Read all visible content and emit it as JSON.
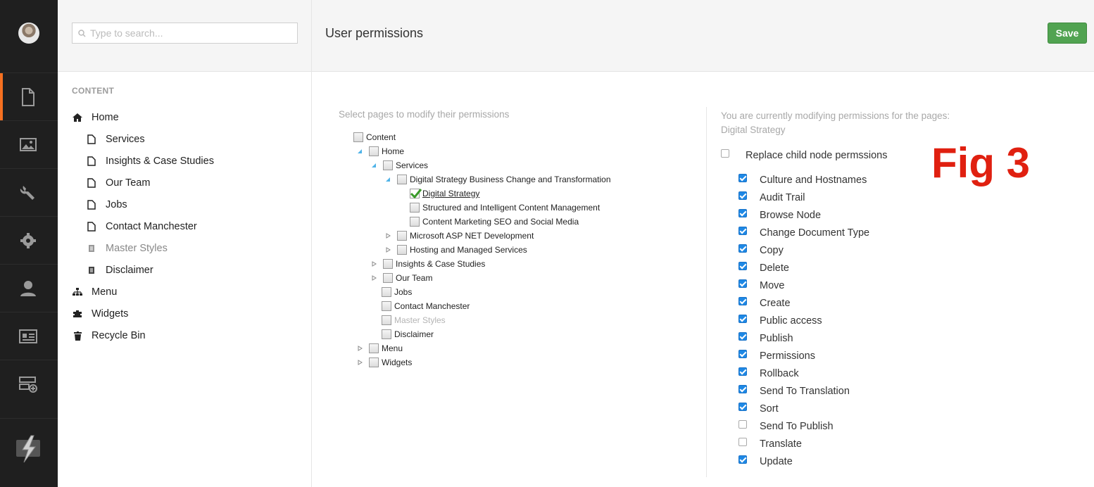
{
  "search": {
    "placeholder": "Type to search..."
  },
  "tree": {
    "section_title": "CONTENT",
    "items": [
      {
        "label": "Home",
        "icon": "home-icon"
      },
      {
        "label": "Services",
        "icon": "document-icon"
      },
      {
        "label": "Insights & Case Studies",
        "icon": "document-icon"
      },
      {
        "label": "Our Team",
        "icon": "document-icon"
      },
      {
        "label": "Jobs",
        "icon": "document-icon"
      },
      {
        "label": "Contact Manchester",
        "icon": "document-icon"
      },
      {
        "label": "Master Styles",
        "icon": "settings-doc-icon"
      },
      {
        "label": "Disclaimer",
        "icon": "settings-doc-icon"
      },
      {
        "label": "Menu",
        "icon": "sitemap-icon"
      },
      {
        "label": "Widgets",
        "icon": "puzzle-icon"
      },
      {
        "label": "Recycle Bin",
        "icon": "trash-icon"
      }
    ]
  },
  "header": {
    "title": "User permissions",
    "save_label": "Save"
  },
  "picker": {
    "label": "Select pages to modify their permissions",
    "nodes": [
      {
        "label": "Content"
      },
      {
        "label": "Home"
      },
      {
        "label": "Services"
      },
      {
        "label": "Digital Strategy Business Change and Transformation"
      },
      {
        "label": "Digital Strategy",
        "checked": true
      },
      {
        "label": "Structured and Intelligent Content Management"
      },
      {
        "label": "Content Marketing SEO and Social Media"
      },
      {
        "label": "Microsoft ASP NET Development"
      },
      {
        "label": "Hosting and Managed Services"
      },
      {
        "label": "Insights & Case Studies"
      },
      {
        "label": "Our Team"
      },
      {
        "label": "Jobs"
      },
      {
        "label": "Contact Manchester"
      },
      {
        "label": "Master Styles"
      },
      {
        "label": "Disclaimer"
      },
      {
        "label": "Menu"
      },
      {
        "label": "Widgets"
      }
    ]
  },
  "permissions": {
    "intro": "You are currently modifying permissions for the pages:",
    "page": "Digital Strategy",
    "replace_label": "Replace child node permssions",
    "replace_checked": false,
    "items": [
      {
        "label": "Culture and Hostnames",
        "checked": true
      },
      {
        "label": "Audit Trail",
        "checked": true
      },
      {
        "label": "Browse Node",
        "checked": true
      },
      {
        "label": "Change Document Type",
        "checked": true
      },
      {
        "label": "Copy",
        "checked": true
      },
      {
        "label": "Delete",
        "checked": true
      },
      {
        "label": "Move",
        "checked": true
      },
      {
        "label": "Create",
        "checked": true
      },
      {
        "label": "Public access",
        "checked": true
      },
      {
        "label": "Publish",
        "checked": true
      },
      {
        "label": "Permissions",
        "checked": true
      },
      {
        "label": "Rollback",
        "checked": true
      },
      {
        "label": "Send To Translation",
        "checked": true
      },
      {
        "label": "Sort",
        "checked": true
      },
      {
        "label": "Send To Publish",
        "checked": false
      },
      {
        "label": "Translate",
        "checked": false
      },
      {
        "label": "Update",
        "checked": true
      }
    ]
  },
  "annotation": "Fig 3",
  "colors": {
    "accent": "#f57020",
    "save": "#51a351",
    "checkbox": "#1e88e5",
    "annotation": "#e02010"
  }
}
